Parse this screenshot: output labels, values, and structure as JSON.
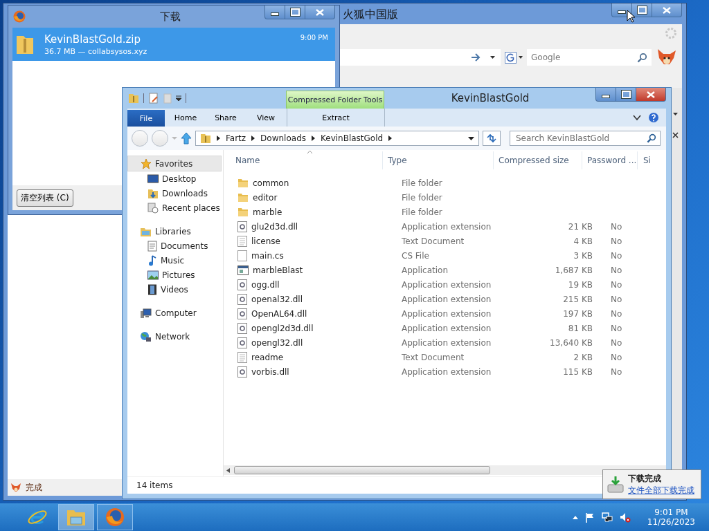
{
  "firefox_window": {
    "title": "火狐中国版",
    "search": {
      "placeholder": "Google"
    },
    "status": "完成"
  },
  "downloads_window": {
    "title": "下载",
    "items": [
      {
        "name": "KevinBlastGold.zip",
        "info": "36.7 MB — collabsysos.xyz",
        "time": "9:00 PM",
        "selected": true
      }
    ],
    "clear_button": "清空列表 (C)"
  },
  "explorer": {
    "title": "KevinBlastGold",
    "context_tab": "Compressed Folder Tools",
    "ribbon_tabs": [
      {
        "label": "File",
        "kind": "file"
      },
      {
        "label": "Home",
        "kind": "tab"
      },
      {
        "label": "Share",
        "kind": "tab"
      },
      {
        "label": "View",
        "kind": "tab"
      },
      {
        "label": "Extract",
        "kind": "context"
      }
    ],
    "breadcrumb": [
      "Fartz",
      "Downloads",
      "KevinBlastGold"
    ],
    "search": {
      "placeholder": "Search KevinBlastGold"
    },
    "nav": [
      {
        "label": "Favorites",
        "kind": "star",
        "selected": true,
        "children": [
          {
            "label": "Desktop",
            "kind": "desktop",
            "selected": false
          },
          {
            "label": "Downloads",
            "kind": "downloads",
            "selected": false
          },
          {
            "label": "Recent places",
            "kind": "recent",
            "selected": false
          }
        ]
      },
      {
        "label": "Libraries",
        "kind": "libraries",
        "selected": false,
        "children": [
          {
            "label": "Documents",
            "kind": "documents",
            "selected": false
          },
          {
            "label": "Music",
            "kind": "music",
            "selected": false
          },
          {
            "label": "Pictures",
            "kind": "pictures",
            "selected": false
          },
          {
            "label": "Videos",
            "kind": "videos",
            "selected": false
          }
        ]
      },
      {
        "label": "Computer",
        "kind": "computer",
        "selected": false
      },
      {
        "label": "Network",
        "kind": "network",
        "selected": false
      }
    ],
    "columns": [
      "Name",
      "Type",
      "Compressed size",
      "Password ...",
      "Si"
    ],
    "rows": [
      {
        "name": "common",
        "type": "File folder",
        "kind": "folder"
      },
      {
        "name": "editor",
        "type": "File folder",
        "kind": "folder"
      },
      {
        "name": "marble",
        "type": "File folder",
        "kind": "folder"
      },
      {
        "name": "glu2d3d.dll",
        "type": "Application extension",
        "size": "21 KB",
        "password": "No",
        "kind": "dll"
      },
      {
        "name": "license",
        "type": "Text Document",
        "size": "4 KB",
        "password": "No",
        "kind": "text"
      },
      {
        "name": "main.cs",
        "type": "CS File",
        "size": "3 KB",
        "password": "No",
        "kind": "file"
      },
      {
        "name": "marbleBlast",
        "type": "Application",
        "size": "1,687 KB",
        "password": "No",
        "kind": "app"
      },
      {
        "name": "ogg.dll",
        "type": "Application extension",
        "size": "19 KB",
        "password": "No",
        "kind": "dll"
      },
      {
        "name": "openal32.dll",
        "type": "Application extension",
        "size": "215 KB",
        "password": "No",
        "kind": "dll"
      },
      {
        "name": "OpenAL64.dll",
        "type": "Application extension",
        "size": "197 KB",
        "password": "No",
        "kind": "dll"
      },
      {
        "name": "opengl2d3d.dll",
        "type": "Application extension",
        "size": "81 KB",
        "password": "No",
        "kind": "dll"
      },
      {
        "name": "opengl32.dll",
        "type": "Application extension",
        "size": "13,640 KB",
        "password": "No",
        "kind": "dll"
      },
      {
        "name": "readme",
        "type": "Text Document",
        "size": "2 KB",
        "password": "No",
        "kind": "text"
      },
      {
        "name": "vorbis.dll",
        "type": "Application extension",
        "size": "115 KB",
        "password": "No",
        "kind": "dll"
      }
    ],
    "status": "14 items"
  },
  "notification": {
    "title": "下载完成",
    "link": "文件全部下载完成"
  },
  "taskbar": {
    "apps": [
      {
        "kind": "ie",
        "open": false,
        "selected": false
      },
      {
        "kind": "explorer",
        "open": true,
        "selected": true
      },
      {
        "kind": "firefox",
        "open": true,
        "selected": false
      }
    ],
    "time": "9:01 PM",
    "date": "11/26/2023"
  }
}
